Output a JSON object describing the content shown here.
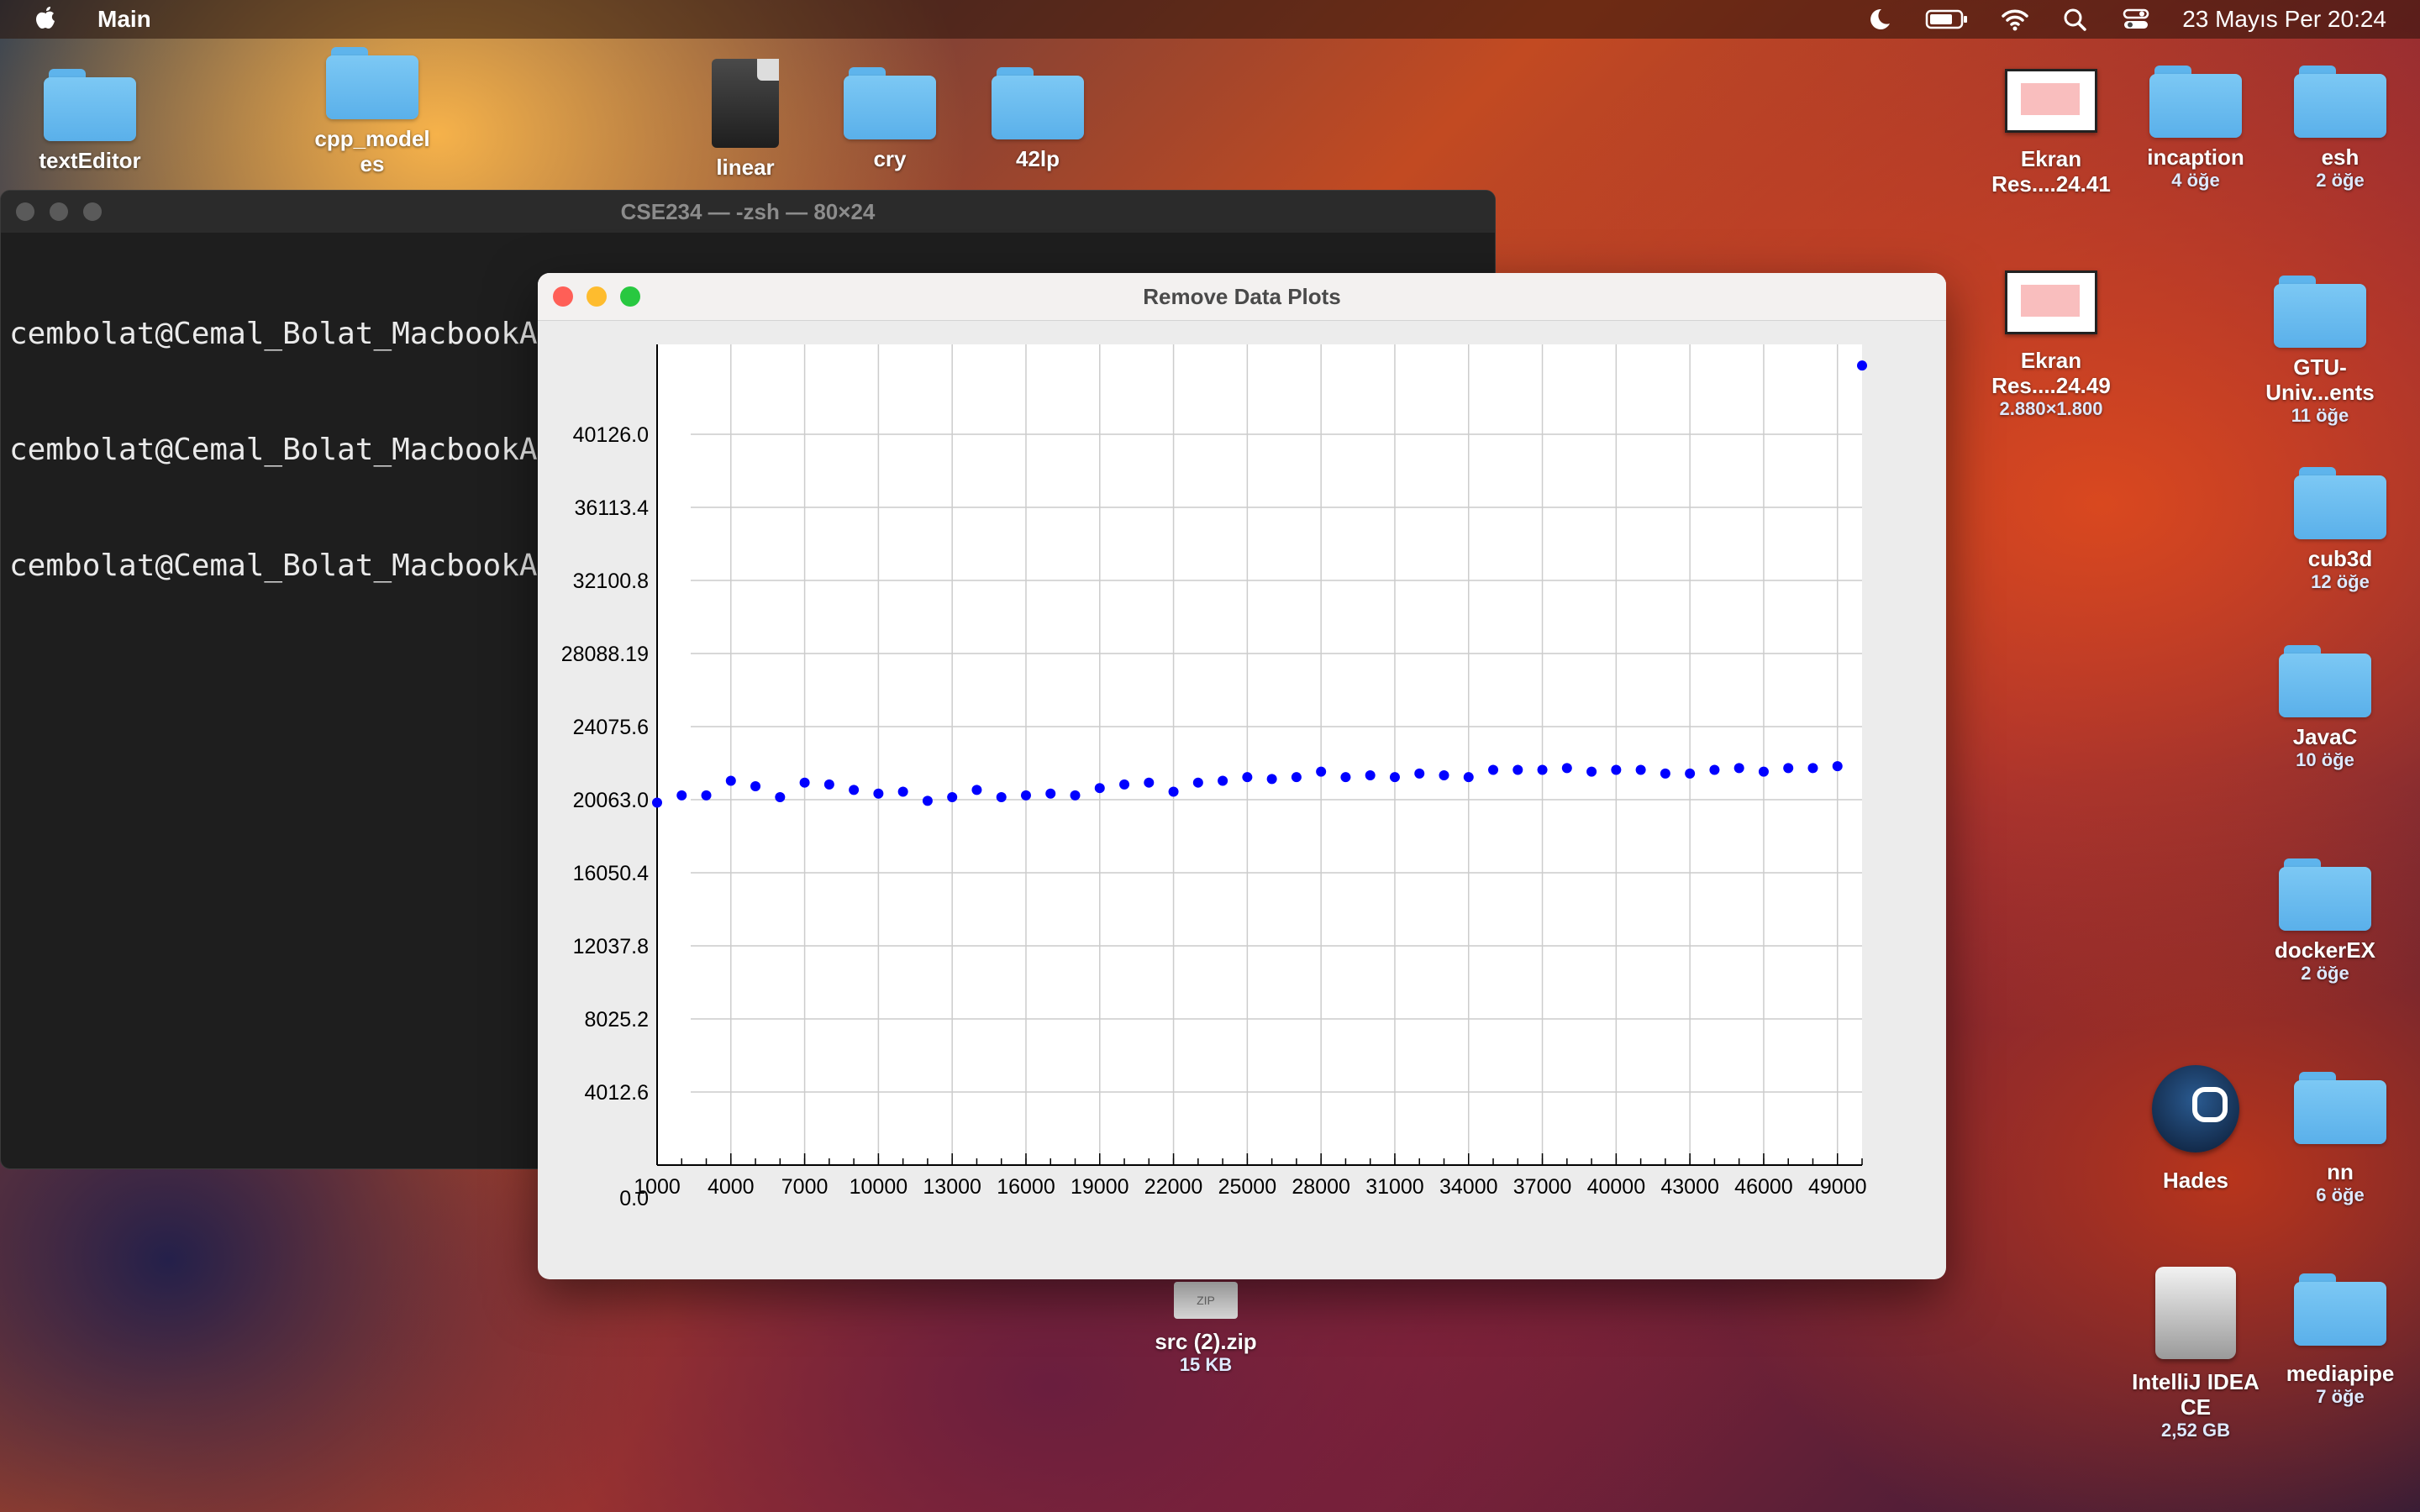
{
  "menubar": {
    "app_name": "Main",
    "datetime": "23 Mayıs Per  20:24",
    "icons": [
      "apple-icon",
      "moon-icon",
      "battery-icon",
      "wifi-icon",
      "search-icon",
      "control-center-icon"
    ]
  },
  "desktop": {
    "top_left": [
      {
        "label": "textEditor",
        "sub": ""
      },
      {
        "label": "cpp_model",
        "sub": "es"
      },
      {
        "label": "linear",
        "sub": ""
      },
      {
        "label": "cry",
        "sub": ""
      },
      {
        "label": "42lp",
        "sub": ""
      }
    ],
    "right": [
      {
        "label": "Ekran",
        "sub": "Res....24.41"
      },
      {
        "label": "incaption",
        "sub": "4 öğe"
      },
      {
        "label": "esh",
        "sub": "2 öğe"
      },
      {
        "label": "Ekran",
        "sub": "Res....24.49",
        "sub2": "2.880×1.800"
      },
      {
        "label": "GTU-",
        "sub": "Univ...ents",
        "sub2": "11 öğe"
      },
      {
        "label": "cub3d",
        "sub": "12 öğe"
      },
      {
        "label": "JavaC",
        "sub": "10 öğe"
      },
      {
        "label": "dockerEX",
        "sub": "2 öğe"
      },
      {
        "label": "Hades",
        "sub": ""
      },
      {
        "label": "nn",
        "sub": "6 öğe"
      },
      {
        "label": "IntelliJ IDEA",
        "sub": "CE",
        "sub2": "2,52 GB"
      },
      {
        "label": "mediapipe",
        "sub": "7 öğe"
      }
    ],
    "zip": {
      "label": "src (2).zip",
      "sub": "15 KB",
      "badge": "ZIP"
    }
  },
  "terminal": {
    "title": "CSE234 — -zsh — 80×24",
    "lines": [
      "cembolat@Cemal_Bolat_MacbookAir CSE234 % open .",
      "cembolat@Cemal_Bolat_MacbookAir",
      "cembolat@Cemal_Bolat_MacbookAir"
    ]
  },
  "plot_window": {
    "title": "Remove Data Plots"
  },
  "chart_data": {
    "type": "scatter",
    "title": "",
    "xlabel": "",
    "ylabel": "",
    "xlim": [
      1000,
      50000
    ],
    "ylim": [
      0,
      44139
    ],
    "x_tick_labels": [
      "1000",
      "4000",
      "7000",
      "10000",
      "13000",
      "16000",
      "19000",
      "22000",
      "25000",
      "28000",
      "31000",
      "34000",
      "37000",
      "40000",
      "43000",
      "46000",
      "49000"
    ],
    "y_tick_labels": [
      "0.0",
      "4012.6",
      "8025.2",
      "12037.8",
      "16050.4",
      "20063.0",
      "24075.6",
      "28088.19",
      "32100.8",
      "36113.4",
      "40126.0"
    ],
    "y_ticks": [
      0,
      4012.6,
      8025.2,
      12037.8,
      16050.4,
      20063.0,
      24075.6,
      28088.19,
      32100.8,
      36113.4,
      40126.0
    ],
    "point_color": "#0000ff",
    "grid": true,
    "series": [
      {
        "x": [
          1000,
          2000,
          3000,
          4000,
          5000,
          6000,
          7000,
          8000,
          9000,
          10000,
          11000,
          12000,
          13000,
          14000,
          15000,
          16000,
          17000,
          18000,
          19000,
          20000,
          21000,
          22000,
          23000,
          24000,
          25000,
          26000,
          27000,
          28000,
          29000,
          30000,
          31000,
          32000,
          33000,
          34000,
          35000,
          36000,
          37000,
          38000,
          39000,
          40000,
          41000,
          42000,
          43000,
          44000,
          45000,
          46000,
          47000,
          48000,
          49000,
          50000
        ],
        "y": [
          19900,
          20300,
          20300,
          21100,
          20800,
          20200,
          21000,
          20900,
          20600,
          20400,
          20500,
          20000,
          20200,
          20600,
          20200,
          20300,
          20400,
          20300,
          20700,
          20900,
          21000,
          20500,
          21000,
          21100,
          21300,
          21200,
          21300,
          21600,
          21300,
          21400,
          21300,
          21500,
          21400,
          21300,
          21700,
          21700,
          21700,
          21800,
          21600,
          21700,
          21700,
          21500,
          21500,
          21700,
          21800,
          21600,
          21800,
          21800,
          21900,
          43900
        ]
      }
    ]
  }
}
